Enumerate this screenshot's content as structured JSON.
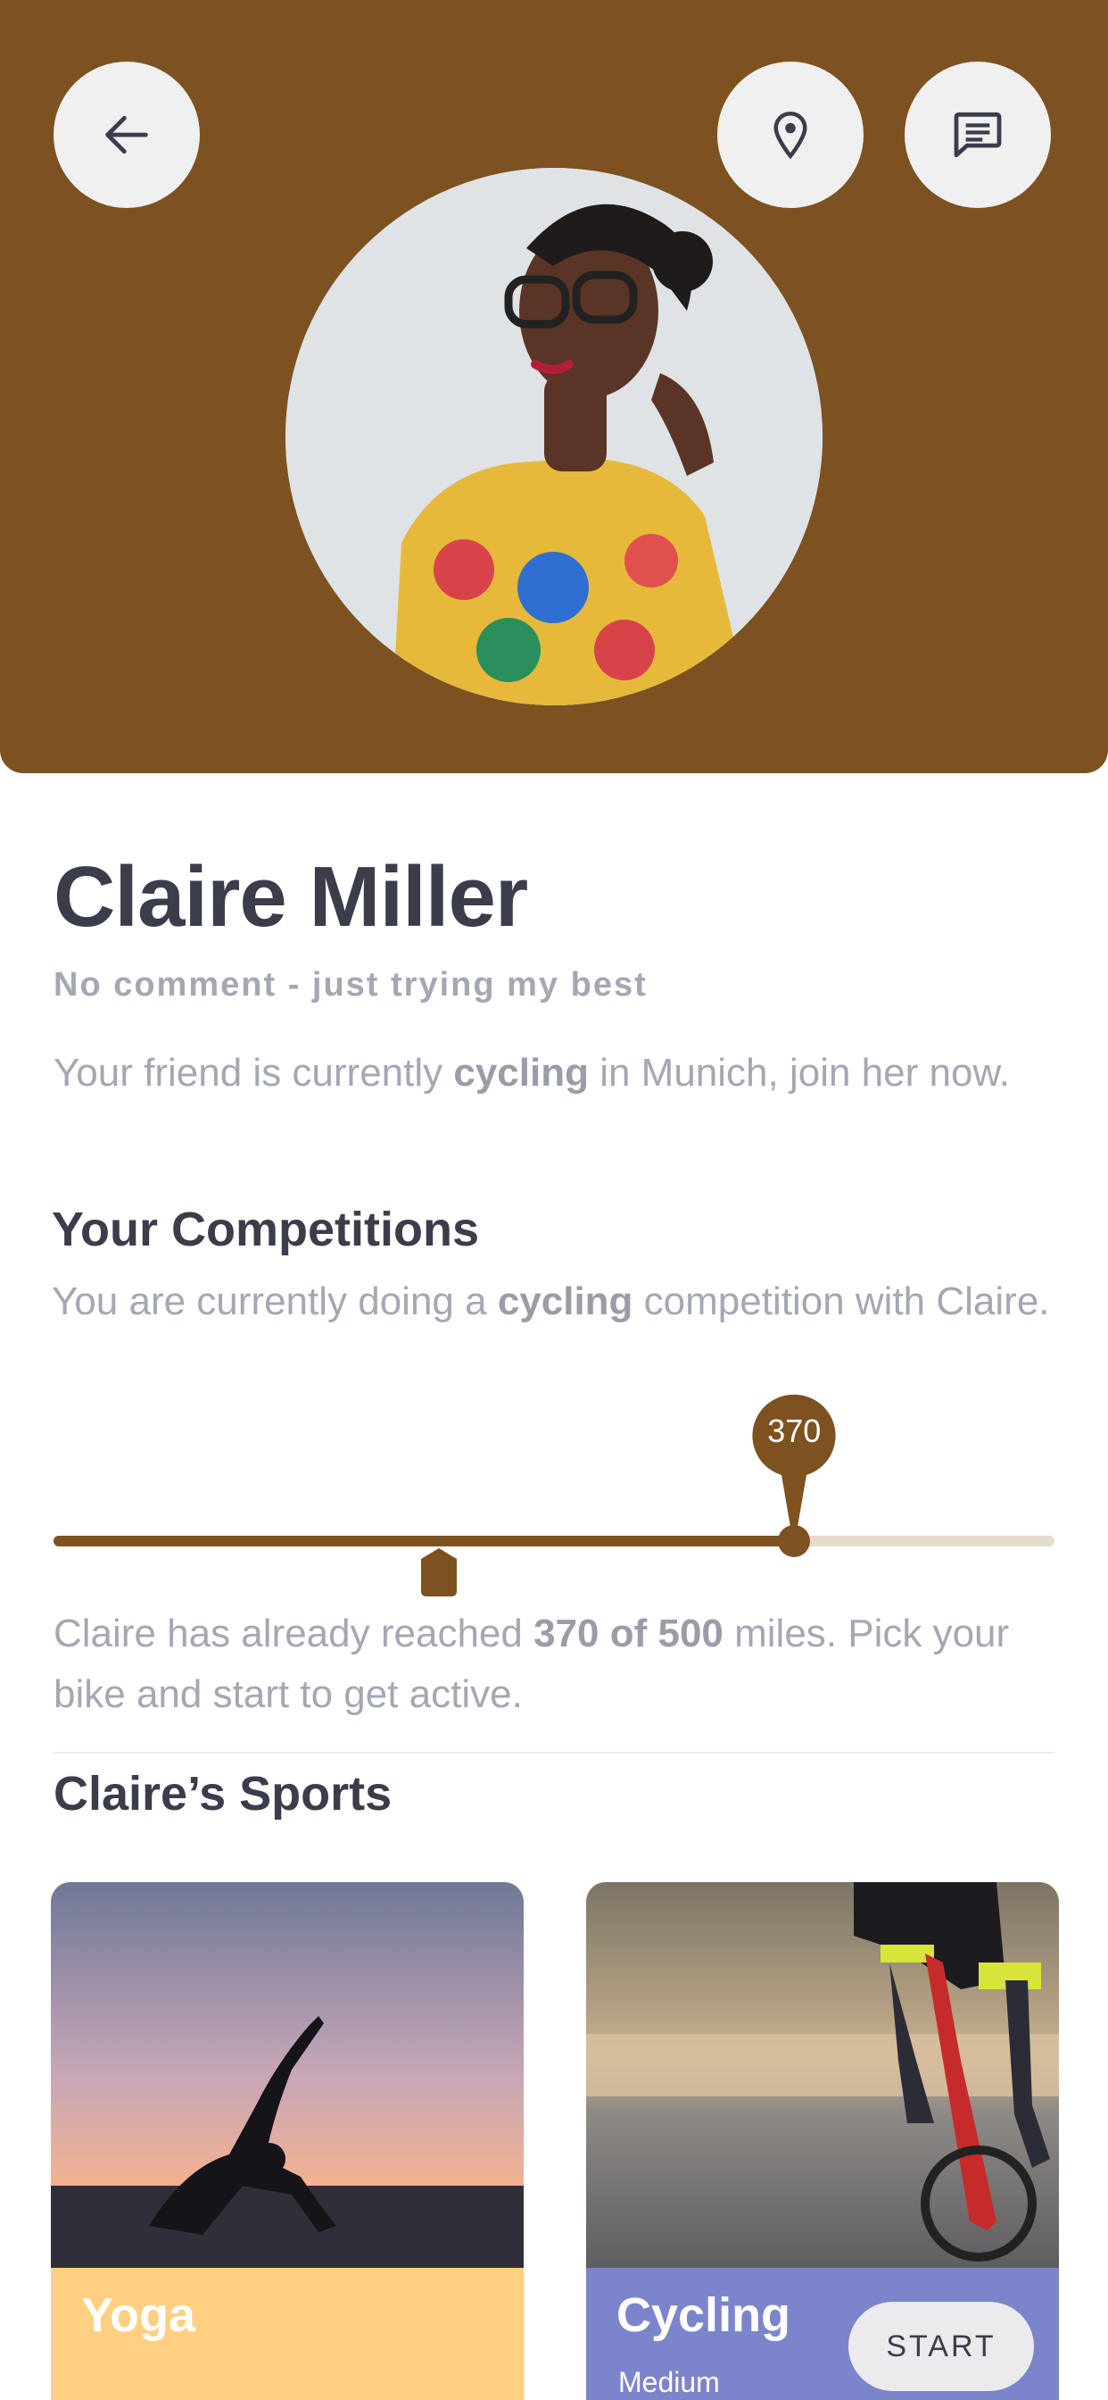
{
  "profile": {
    "name": "Claire Miller",
    "tagline": "No comment - just trying my best",
    "status": {
      "prefix": "Your friend is currently ",
      "activity": "cycling",
      "suffix": " in Munich, join her now."
    }
  },
  "competitions": {
    "title": "Your Competitions",
    "desc_prefix": "You are currently doing a ",
    "desc_activity": "cycling",
    "desc_suffix": " competition with Claire.",
    "slider": {
      "value": 370,
      "max": 500,
      "value_label": "370",
      "marker_fraction": 0.385
    },
    "progress_prefix": "Claire has already reached ",
    "progress_bold": "370 of 500",
    "progress_suffix": " miles. Pick your bike and start to get active."
  },
  "sports": {
    "title": "Claire’s Sports",
    "cards": [
      {
        "title": "Yoga",
        "subtitle": ""
      },
      {
        "title": "Cycling",
        "subtitle": "Medium",
        "button": "START"
      }
    ]
  },
  "colors": {
    "brand": "#7d5220",
    "text_dark": "#3b3d4b",
    "text_muted": "#a5a7b2",
    "yoga_card": "#ffcf82",
    "cycling_card": "#7c85cc"
  },
  "icons": {
    "back": "arrow-left-icon",
    "location": "location-pin-icon",
    "chat": "chat-icon"
  }
}
